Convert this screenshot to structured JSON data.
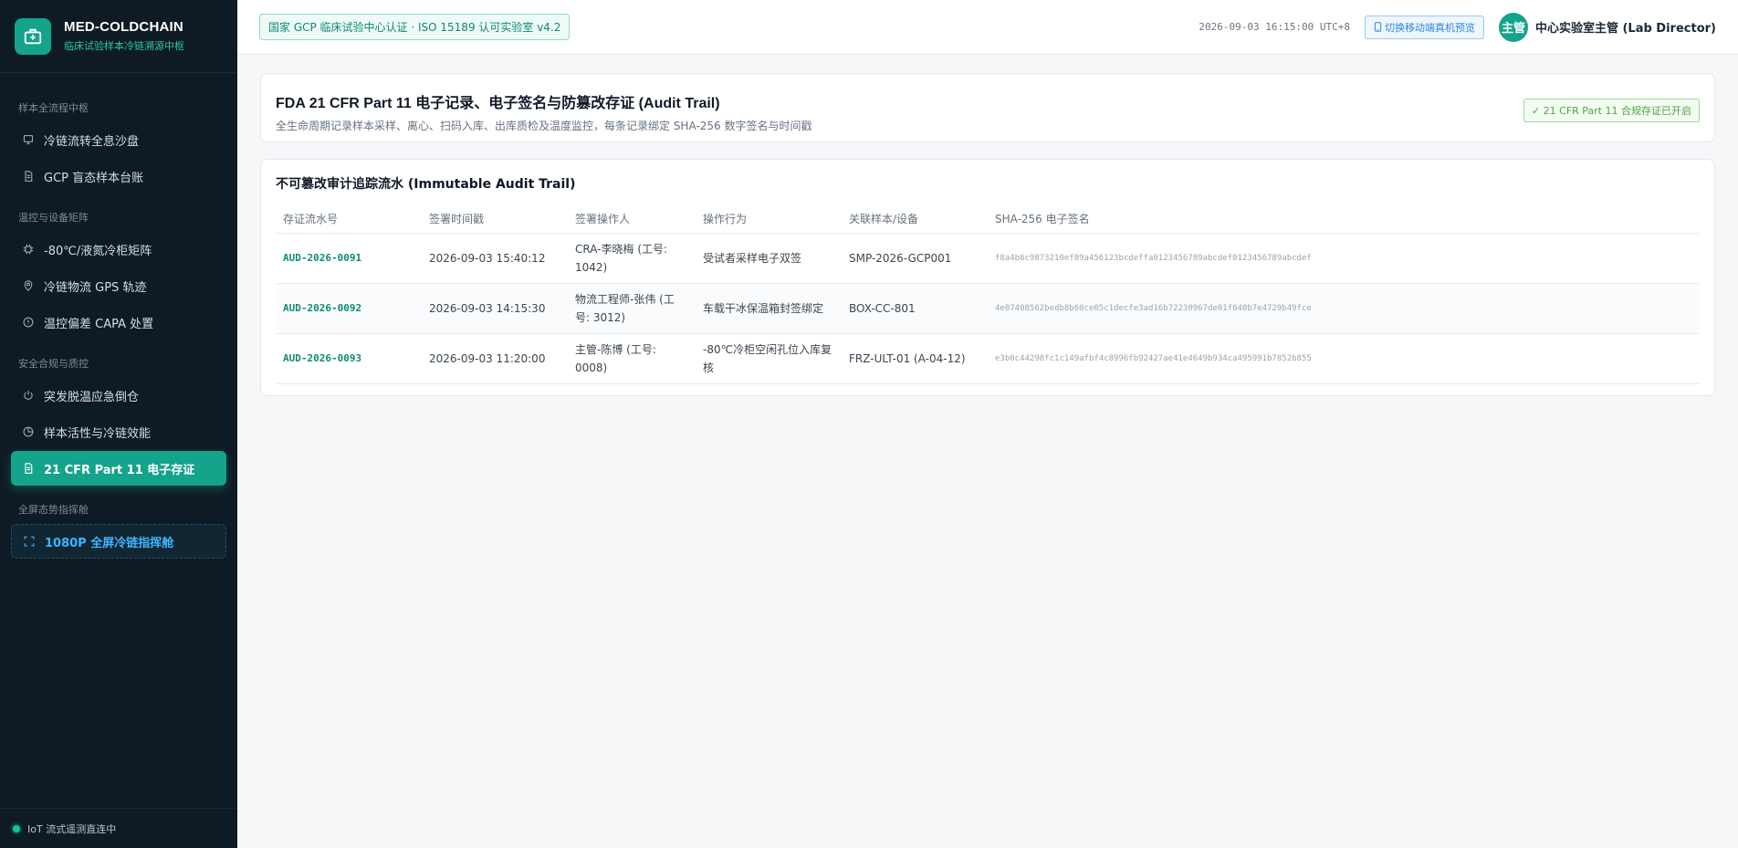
{
  "brand": {
    "title": "MED-COLDCHAIN",
    "subtitle": "临床试验样本冷链溯源中枢"
  },
  "sidebar": {
    "groups": [
      {
        "label": "样本全流程中枢"
      },
      {
        "label": "温控与设备矩阵"
      },
      {
        "label": "安全合规与质控"
      },
      {
        "label": "全屏态势指挥舱"
      }
    ],
    "items": [
      {
        "label": "冷链流转全息沙盘",
        "icon": "monitor-icon"
      },
      {
        "label": "GCP 盲态样本台账",
        "icon": "document-icon"
      },
      {
        "label": "-80℃/液氮冷柜矩阵",
        "icon": "chip-icon"
      },
      {
        "label": "冷链物流 GPS 轨迹",
        "icon": "location-icon"
      },
      {
        "label": "温控偏差 CAPA 处置",
        "icon": "warning-icon"
      },
      {
        "label": "突发脱温应急倒仓",
        "icon": "power-icon"
      },
      {
        "label": "样本活性与冷链效能",
        "icon": "pie-chart-icon"
      },
      {
        "label": "21 CFR Part 11 电子存证",
        "icon": "document-icon"
      },
      {
        "label": "1080P 全屏冷链指挥舱",
        "icon": "fullscreen-icon"
      }
    ],
    "footer_status": "IoT 流式遥测直连中"
  },
  "header": {
    "cert_badge": "国家 GCP 临床试验中心认证 · ISO 15189 认可实验室 v4.2",
    "datetime": "2026-09-03 16:15:00 UTC+8",
    "mobile_button": "切换移动端真机预览",
    "avatar_text": "主管",
    "user_name": "中心实验室主管 (Lab Director)"
  },
  "page": {
    "title": "FDA 21 CFR Part 11 电子记录、电子签名与防篡改存证 (Audit Trail)",
    "subtitle": "全生命周期记录样本采样、离心、扫码入库、出库质检及温度监控，每条记录绑定 SHA-256 数字签名与时间戳",
    "compliance_badge": "✓ 21 CFR Part 11 合规存证已开启"
  },
  "audit": {
    "section_title": "不可篡改审计追踪流水 (Immutable Audit Trail)",
    "columns": [
      "存证流水号",
      "签署时间戳",
      "签署操作人",
      "操作行为",
      "关联样本/设备",
      "SHA-256 电子签名"
    ],
    "rows": [
      {
        "id": "AUD-2026-0091",
        "timestamp": "2026-09-03 15:40:12",
        "operator": "CRA-李晓梅 (工号: 1042)",
        "action": "受试者采样电子双签",
        "ref": "SMP-2026-GCP001",
        "hash": "f8a4b6c9873210ef89a456123bcdeffa0123456789abcdef0123456789abcdef"
      },
      {
        "id": "AUD-2026-0092",
        "timestamp": "2026-09-03 14:15:30",
        "operator": "物流工程师-张伟 (工号: 3012)",
        "action": "车载干冰保温箱封签绑定",
        "ref": "BOX-CC-801",
        "hash": "4e07408562bedb8b60ce05c1decfe3ad16b72230967de01f640b7e4729b49fce"
      },
      {
        "id": "AUD-2026-0093",
        "timestamp": "2026-09-03 11:20:00",
        "operator": "主管-陈博 (工号: 0008)",
        "action": "-80℃冷柜空闲孔位入库复核",
        "ref": "FRZ-ULT-01 (A-04-12)",
        "hash": "e3b0c44298fc1c149afbf4c8996fb92427ae41e4649b934ca495991b7852b855"
      }
    ]
  }
}
